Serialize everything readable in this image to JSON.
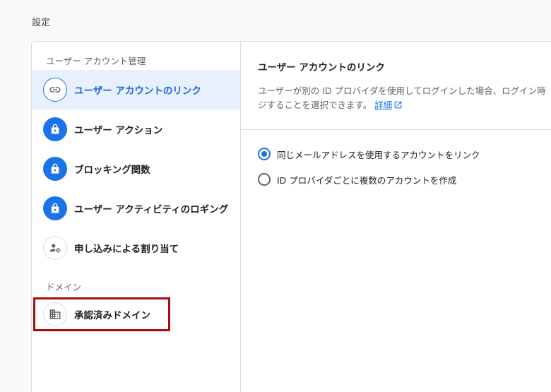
{
  "page": {
    "title": "設定"
  },
  "sidebar": {
    "sections": [
      {
        "label": "ユーザー アカウント管理",
        "items": [
          {
            "label": "ユーザー アカウントのリンク",
            "icon": "link-icon",
            "active": true
          },
          {
            "label": "ユーザー アクション",
            "icon": "lock-icon"
          },
          {
            "label": "ブロッキング関数",
            "icon": "lock-icon"
          },
          {
            "label": "ユーザー アクティビティのロギング",
            "icon": "lock-icon"
          },
          {
            "label": "申し込みによる割り当て",
            "icon": "person-gear-icon"
          }
        ]
      },
      {
        "label": "ドメイン",
        "items": [
          {
            "label": "承認済みドメイン",
            "icon": "building-icon",
            "highlighted": true
          }
        ]
      }
    ]
  },
  "content": {
    "title": "ユーザー アカウントのリンク",
    "description_line1": "ユーザーが別の ID プロバイダを使用してログインした場合、ログイン時",
    "description_line2": "ジすることを選択できます。",
    "details_link": "詳細",
    "options": [
      {
        "label": "同じメールアドレスを使用するアカウントをリンク",
        "checked": true
      },
      {
        "label": "ID プロバイダごとに複数のアカウントを作成",
        "checked": false
      }
    ]
  },
  "colors": {
    "accent": "#1a73e8",
    "active_bg": "#e8f0fe",
    "highlight_border": "#a50e0e"
  }
}
